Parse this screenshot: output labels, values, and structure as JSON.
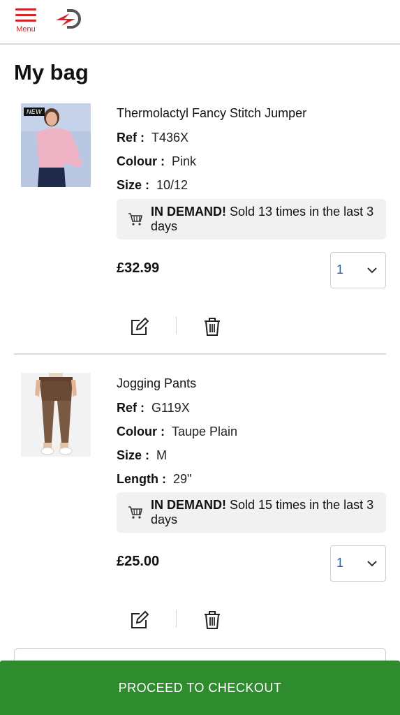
{
  "header": {
    "menu_label": "Menu"
  },
  "page": {
    "title": "My bag"
  },
  "items": [
    {
      "badge": "NEW",
      "name": "Thermolactyl Fancy Stitch Jumper",
      "attributes": [
        {
          "label": "Ref :",
          "value": "T436X"
        },
        {
          "label": "Colour :",
          "value": "Pink"
        },
        {
          "label": "Size :",
          "value": "10/12"
        }
      ],
      "demand_bold": "IN DEMAND!",
      "demand_text": "Sold 13 times in the last 3 days",
      "price": "£32.99",
      "quantity": "1"
    },
    {
      "name": "Jogging Pants",
      "attributes": [
        {
          "label": "Ref :",
          "value": "G119X"
        },
        {
          "label": "Colour :",
          "value": "Taupe Plain"
        },
        {
          "label": "Size :",
          "value": "M"
        },
        {
          "label": "Length :",
          "value": "29\""
        }
      ],
      "demand_bold": "IN DEMAND!",
      "demand_text": "Sold 15 times in the last 3 days",
      "price": "£25.00",
      "quantity": "1"
    }
  ],
  "checkout": {
    "label": "PROCEED TO CHECKOUT"
  },
  "colors": {
    "brand_red": "#d0262a",
    "checkout_green": "#2e8b2e",
    "qty_blue": "#1a63c9"
  }
}
